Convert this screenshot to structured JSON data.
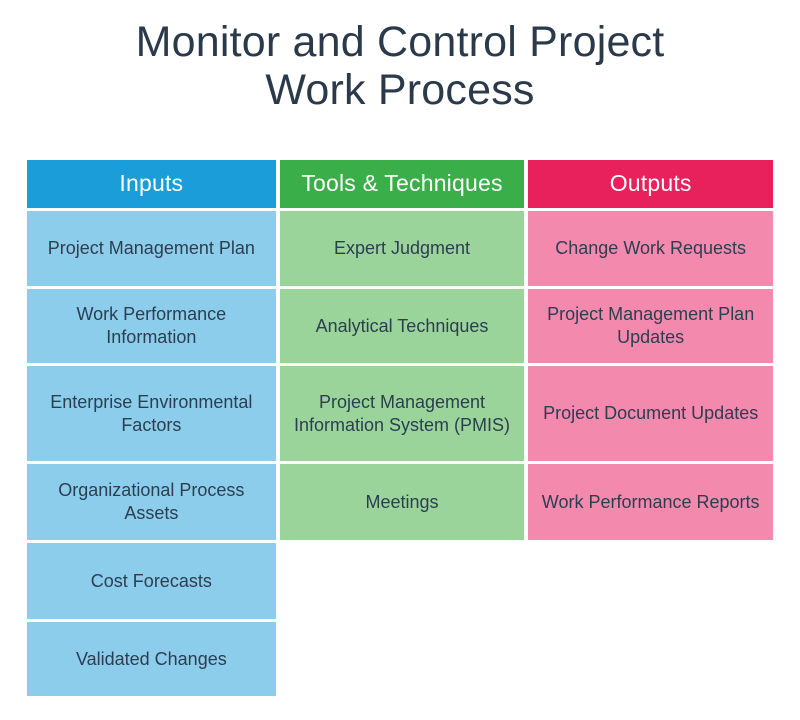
{
  "title": {
    "line1": "Monitor and Control Project",
    "line2": "Work Process",
    "color": "#2b3a4a"
  },
  "colors": {
    "inputs_header": "#1b9dd9",
    "inputs_cell": "#8ccdeb",
    "tools_header": "#3aae49",
    "tools_cell": "#9ad49b",
    "outputs_header": "#e8205c",
    "outputs_cell": "#f389ad",
    "cell_text": "#2c3e50",
    "header_text": "#ffffff",
    "background": "#ffffff"
  },
  "columns": [
    {
      "key": "inputs",
      "header": "Inputs",
      "items": [
        "Project Management Plan",
        "Work Performance Information",
        "Enterprise Environmental Factors",
        "Organizational Process Assets",
        "Cost Forecasts",
        "Validated Changes"
      ]
    },
    {
      "key": "tools",
      "header": "Tools & Techniques",
      "items": [
        "Expert Judgment",
        "Analytical Techniques",
        "Project Management Information System (PMIS)",
        "Meetings"
      ]
    },
    {
      "key": "outputs",
      "header": "Outputs",
      "items": [
        "Change Work Requests",
        "Project Management Plan Updates",
        "Project Document Updates",
        "Work Performance Reports"
      ]
    }
  ]
}
